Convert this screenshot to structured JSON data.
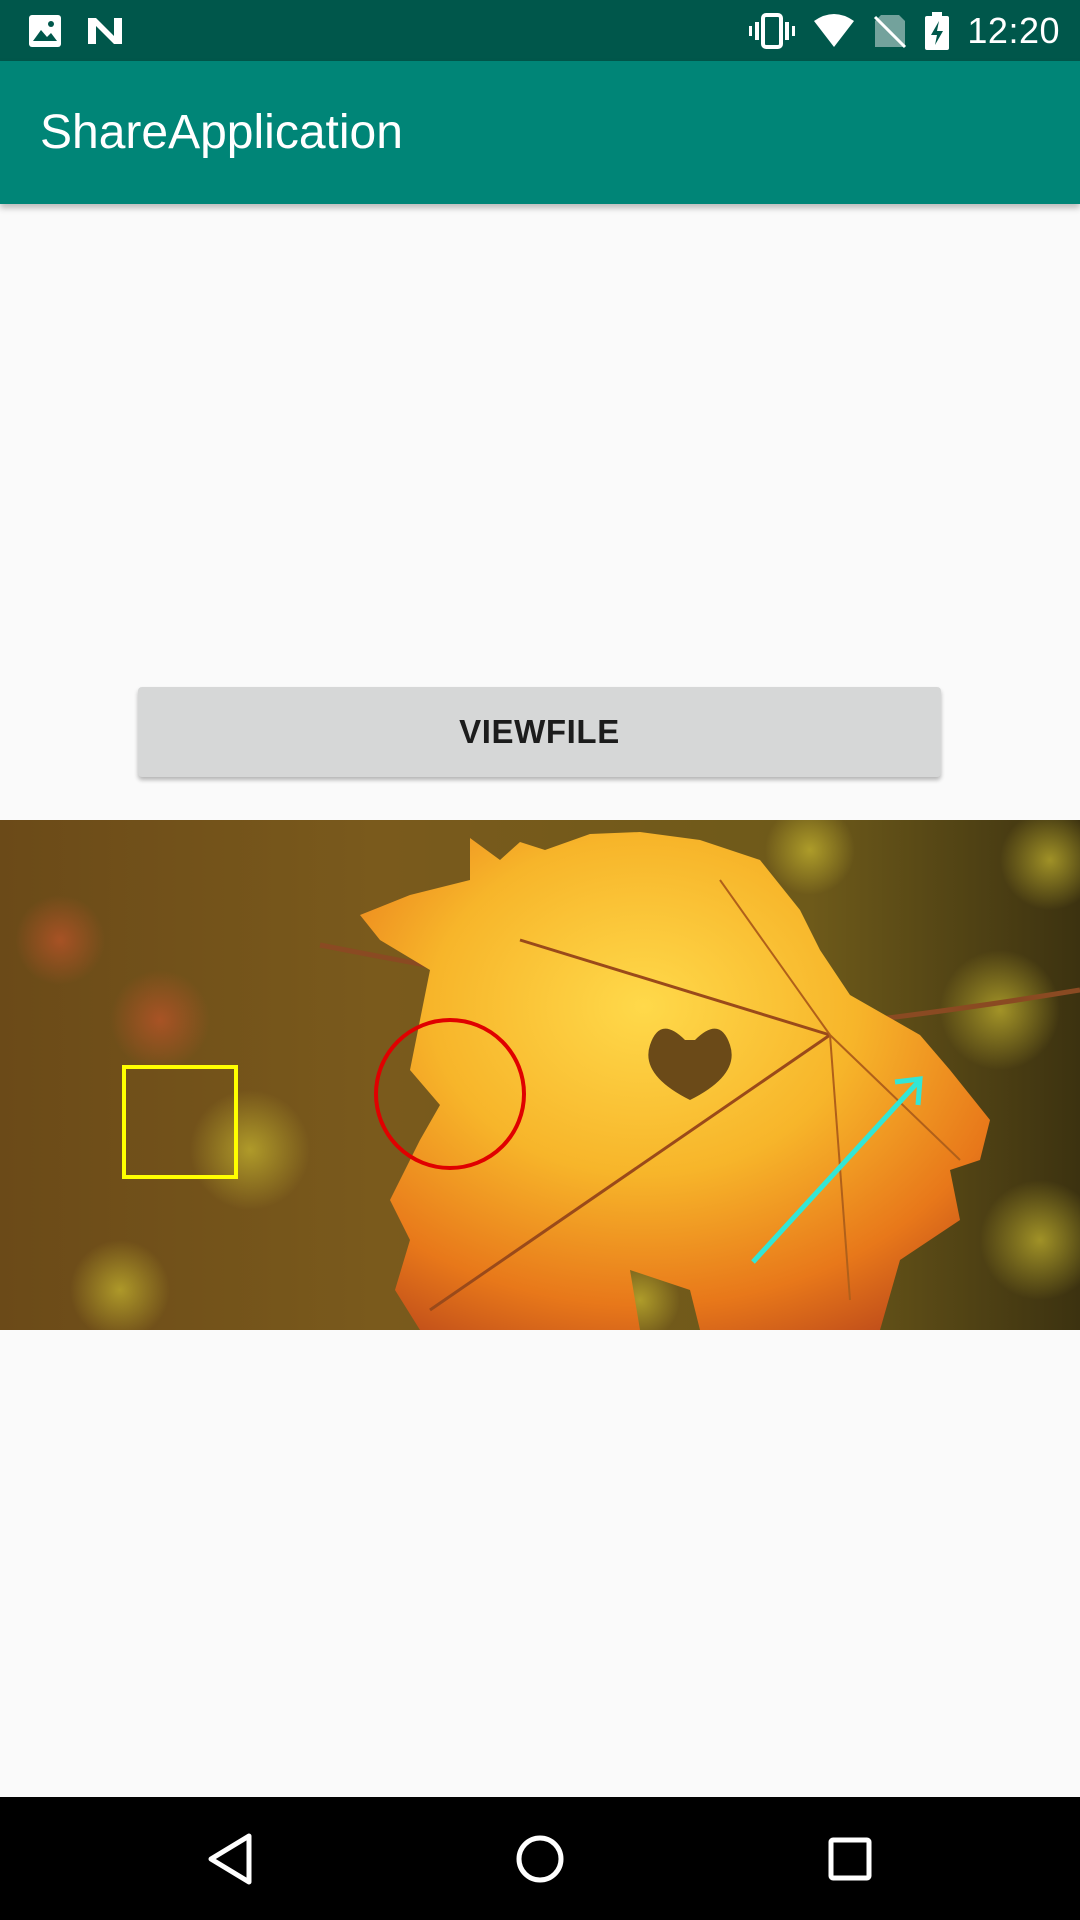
{
  "status_bar": {
    "time": "12:20",
    "left_icons": [
      "image-notification-icon",
      "n-notification-icon"
    ],
    "right_icons": [
      "vibrate-icon",
      "wifi-icon",
      "no-sim-icon",
      "battery-charging-icon"
    ],
    "background": "#00574b"
  },
  "app_bar": {
    "title": "ShareApplication",
    "background": "#008577"
  },
  "main": {
    "viewfile_button_label": "VIEWFILE"
  },
  "image": {
    "annotations": [
      {
        "shape": "rectangle",
        "color": "#ffff00"
      },
      {
        "shape": "circle",
        "color": "#e00000"
      },
      {
        "shape": "arrow",
        "color": "#33e6d6"
      }
    ]
  },
  "nav_bar": {
    "buttons": [
      "back-icon",
      "home-icon",
      "recents-icon"
    ]
  }
}
